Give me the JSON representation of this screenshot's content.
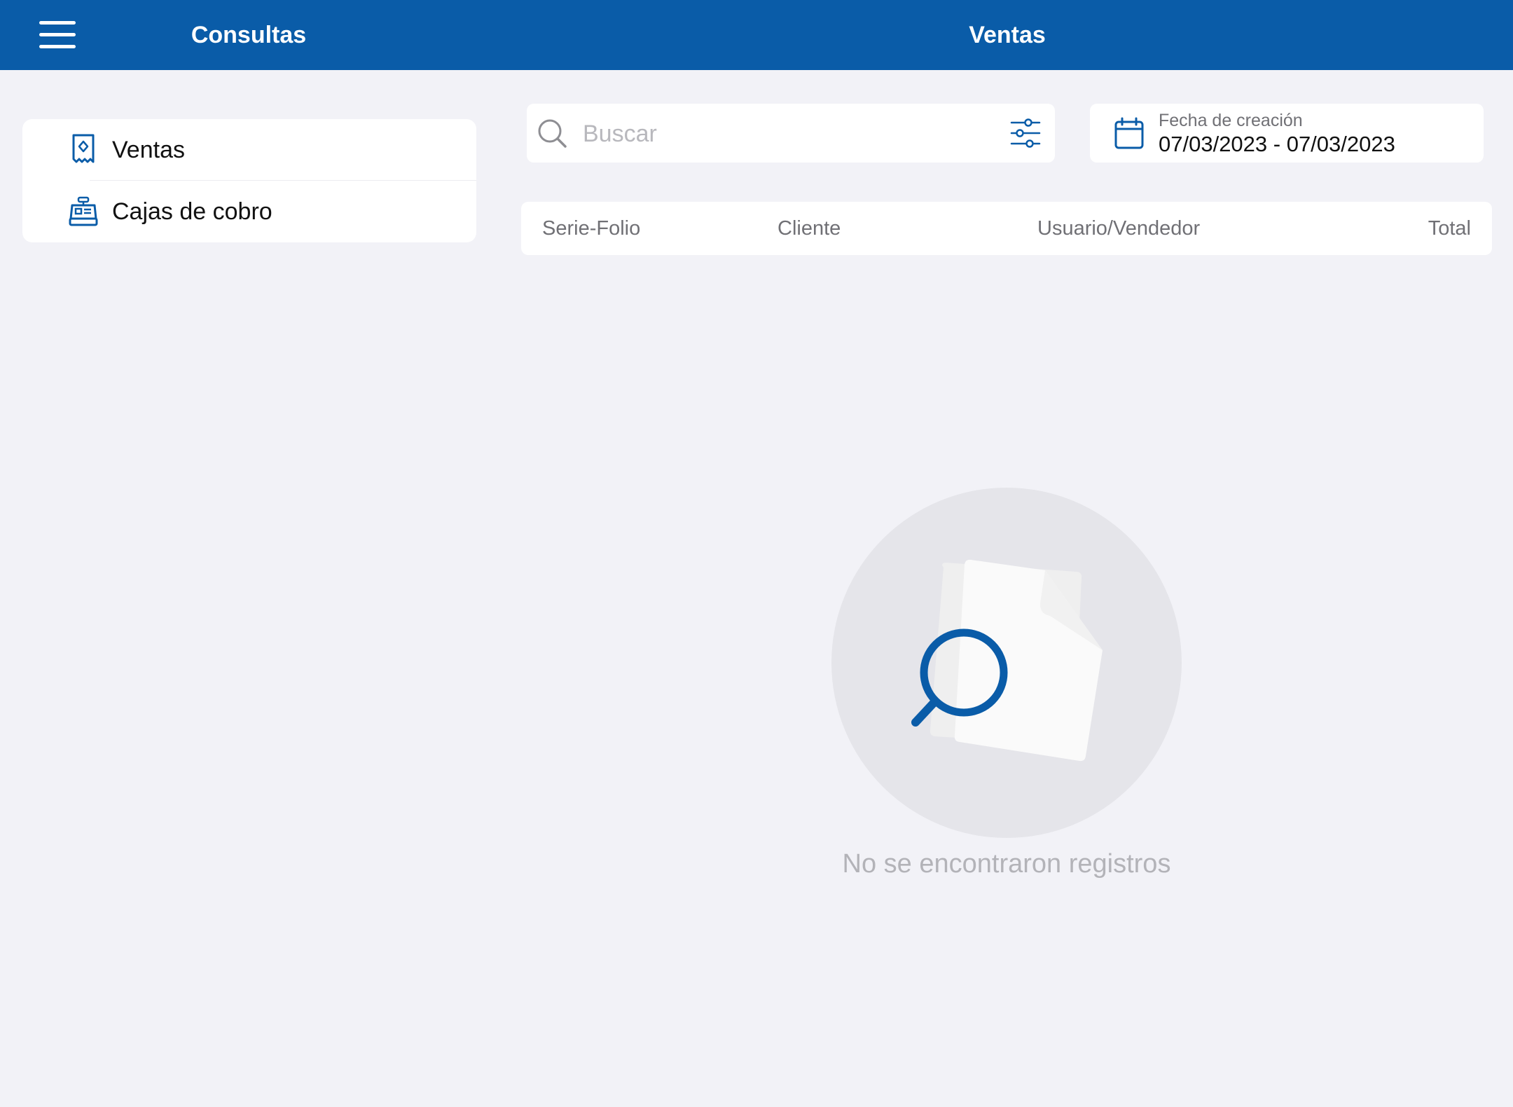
{
  "header": {
    "left_title": "Consultas",
    "main_title": "Ventas",
    "color": "#0a5ca8"
  },
  "sidebar": {
    "items": [
      {
        "label": "Ventas",
        "icon": "receipt-icon"
      },
      {
        "label": "Cajas de cobro",
        "icon": "cash-register-icon"
      }
    ]
  },
  "search": {
    "placeholder": "Buscar",
    "value": ""
  },
  "date_filter": {
    "caption": "Fecha de creación",
    "value": "07/03/2023 - 07/03/2023"
  },
  "table": {
    "columns": [
      "Serie-Folio",
      "Cliente",
      "Usuario/Vendedor",
      "Total"
    ]
  },
  "empty_state": {
    "message": "No se encontraron registros",
    "icon": "document-search-icon"
  }
}
